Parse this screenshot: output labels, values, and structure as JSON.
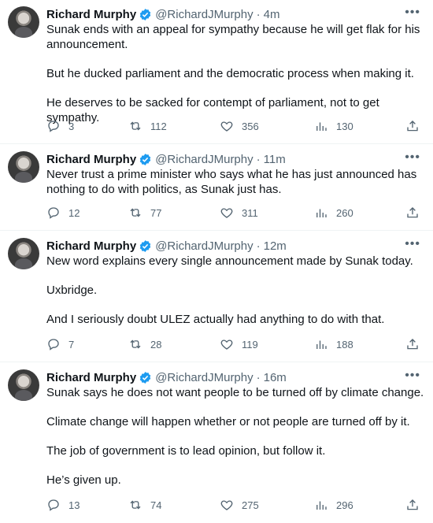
{
  "tweets": [
    {
      "author": "Richard Murphy",
      "handle": "@RichardJMurphy",
      "time": "4m",
      "paragraphs": [
        "Sunak ends with an appeal for sympathy because he will get flak for his announcement.",
        "But he ducked parliament and the democratic process when making it.",
        "He deserves to be sacked for contempt of parliament, not to get sympathy."
      ],
      "replies": "3",
      "retweets": "112",
      "likes": "356",
      "views": "130"
    },
    {
      "author": "Richard Murphy",
      "handle": "@RichardJMurphy",
      "time": "11m",
      "paragraphs": [
        "Never trust a prime minister who says what he has just announced has nothing to do with politics, as Sunak just has."
      ],
      "replies": "12",
      "retweets": "77",
      "likes": "311",
      "views": "260"
    },
    {
      "author": "Richard Murphy",
      "handle": "@RichardJMurphy",
      "time": "12m",
      "paragraphs": [
        "New word explains every single announcement made by Sunak today.",
        "Uxbridge.",
        "And I seriously doubt ULEZ actually had anything to do with that."
      ],
      "replies": "7",
      "retweets": "28",
      "likes": "119",
      "views": "188"
    },
    {
      "author": "Richard Murphy",
      "handle": "@RichardJMurphy",
      "time": "16m",
      "paragraphs": [
        "Sunak says he does not want people to be turned off by climate change.",
        "Climate change will happen whether or not people are turned off by it.",
        "The job of government is to lead opinion, but follow it.",
        "He’s given up."
      ],
      "replies": "13",
      "retweets": "74",
      "likes": "275",
      "views": "296"
    }
  ],
  "icons": {
    "more": "more-icon",
    "verified": "verified-badge-icon",
    "reply": "reply-icon",
    "retweet": "retweet-icon",
    "like": "like-icon",
    "views": "views-icon",
    "share": "share-icon"
  },
  "colors": {
    "text": "#0f1419",
    "secondary": "#536471",
    "verified": "#1d9bf0",
    "divider": "#eff3f4"
  }
}
